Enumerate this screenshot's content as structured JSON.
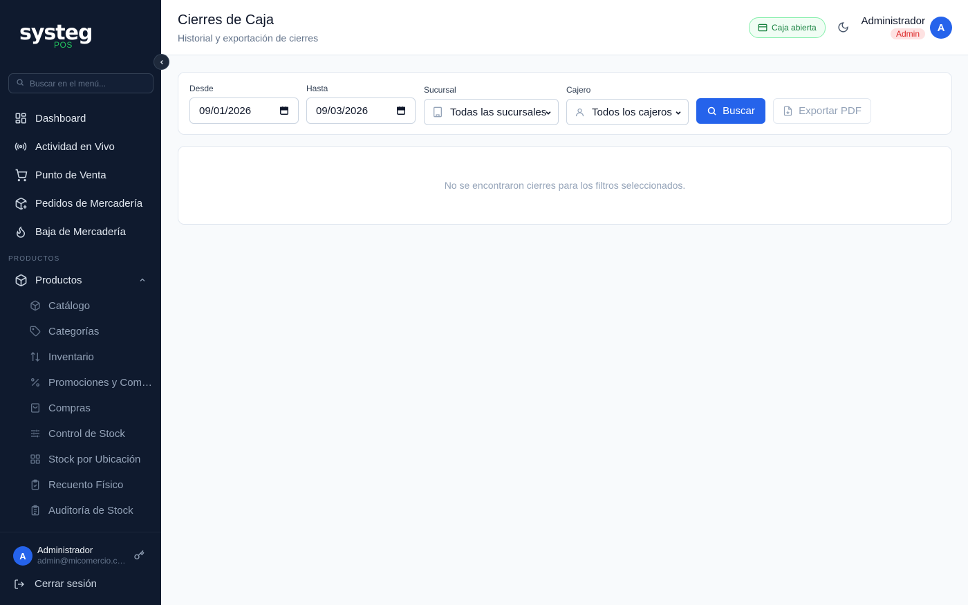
{
  "brand": {
    "name": "systeg",
    "sub": "POS",
    "accent": "#22c55e"
  },
  "sidebar": {
    "search_placeholder": "Buscar en el menú...",
    "items": [
      {
        "label": "Dashboard",
        "icon": "grid-icon"
      },
      {
        "label": "Actividad en Vivo",
        "icon": "broadcast-icon"
      },
      {
        "label": "Punto de Venta",
        "icon": "cart-icon"
      },
      {
        "label": "Pedidos de Mercadería",
        "icon": "package-plus-icon"
      },
      {
        "label": "Baja de Mercadería",
        "icon": "flame-icon"
      }
    ],
    "section_label": "PRODUCTOS",
    "group": {
      "label": "Productos",
      "icon": "box-icon"
    },
    "sub_items": [
      {
        "label": "Catálogo",
        "icon": "box-icon"
      },
      {
        "label": "Categorías",
        "icon": "tag-icon"
      },
      {
        "label": "Inventario",
        "icon": "arrows-updown-icon"
      },
      {
        "label": "Promociones y Combos",
        "icon": "percent-icon"
      },
      {
        "label": "Compras",
        "icon": "shopping-bag-icon"
      },
      {
        "label": "Control de Stock",
        "icon": "sliders-icon"
      },
      {
        "label": "Stock por Ubicación",
        "icon": "grid-icon"
      },
      {
        "label": "Recuento Físico",
        "icon": "clipboard-check-icon"
      },
      {
        "label": "Auditoría de Stock",
        "icon": "clipboard-list-icon"
      }
    ],
    "footer": {
      "avatar_initial": "A",
      "user_name": "Administrador",
      "user_email": "admin@micomercio.com",
      "logout_label": "Cerrar sesión"
    }
  },
  "header": {
    "title": "Cierres de Caja",
    "subtitle": "Historial y exportación de cierres",
    "status_badge": "Caja abierta",
    "user_name": "Administrador",
    "user_role": "Admin",
    "avatar_initial": "A"
  },
  "filters": {
    "from_label": "Desde",
    "from_value": "09/01/2026",
    "to_label": "Hasta",
    "to_value": "09/03/2026",
    "branch_label": "Sucursal",
    "branch_value": "Todas las sucursales",
    "cashier_label": "Cajero",
    "cashier_value": "Todos los cajeros",
    "search_button": "Buscar",
    "export_button": "Exportar PDF"
  },
  "results": {
    "empty_message": "No se encontraron cierres para los filtros seleccionados."
  },
  "colors": {
    "sidebar_bg": "#0f1a2e",
    "primary": "#2563eb",
    "success": "#15803d",
    "danger": "#dc2626"
  }
}
